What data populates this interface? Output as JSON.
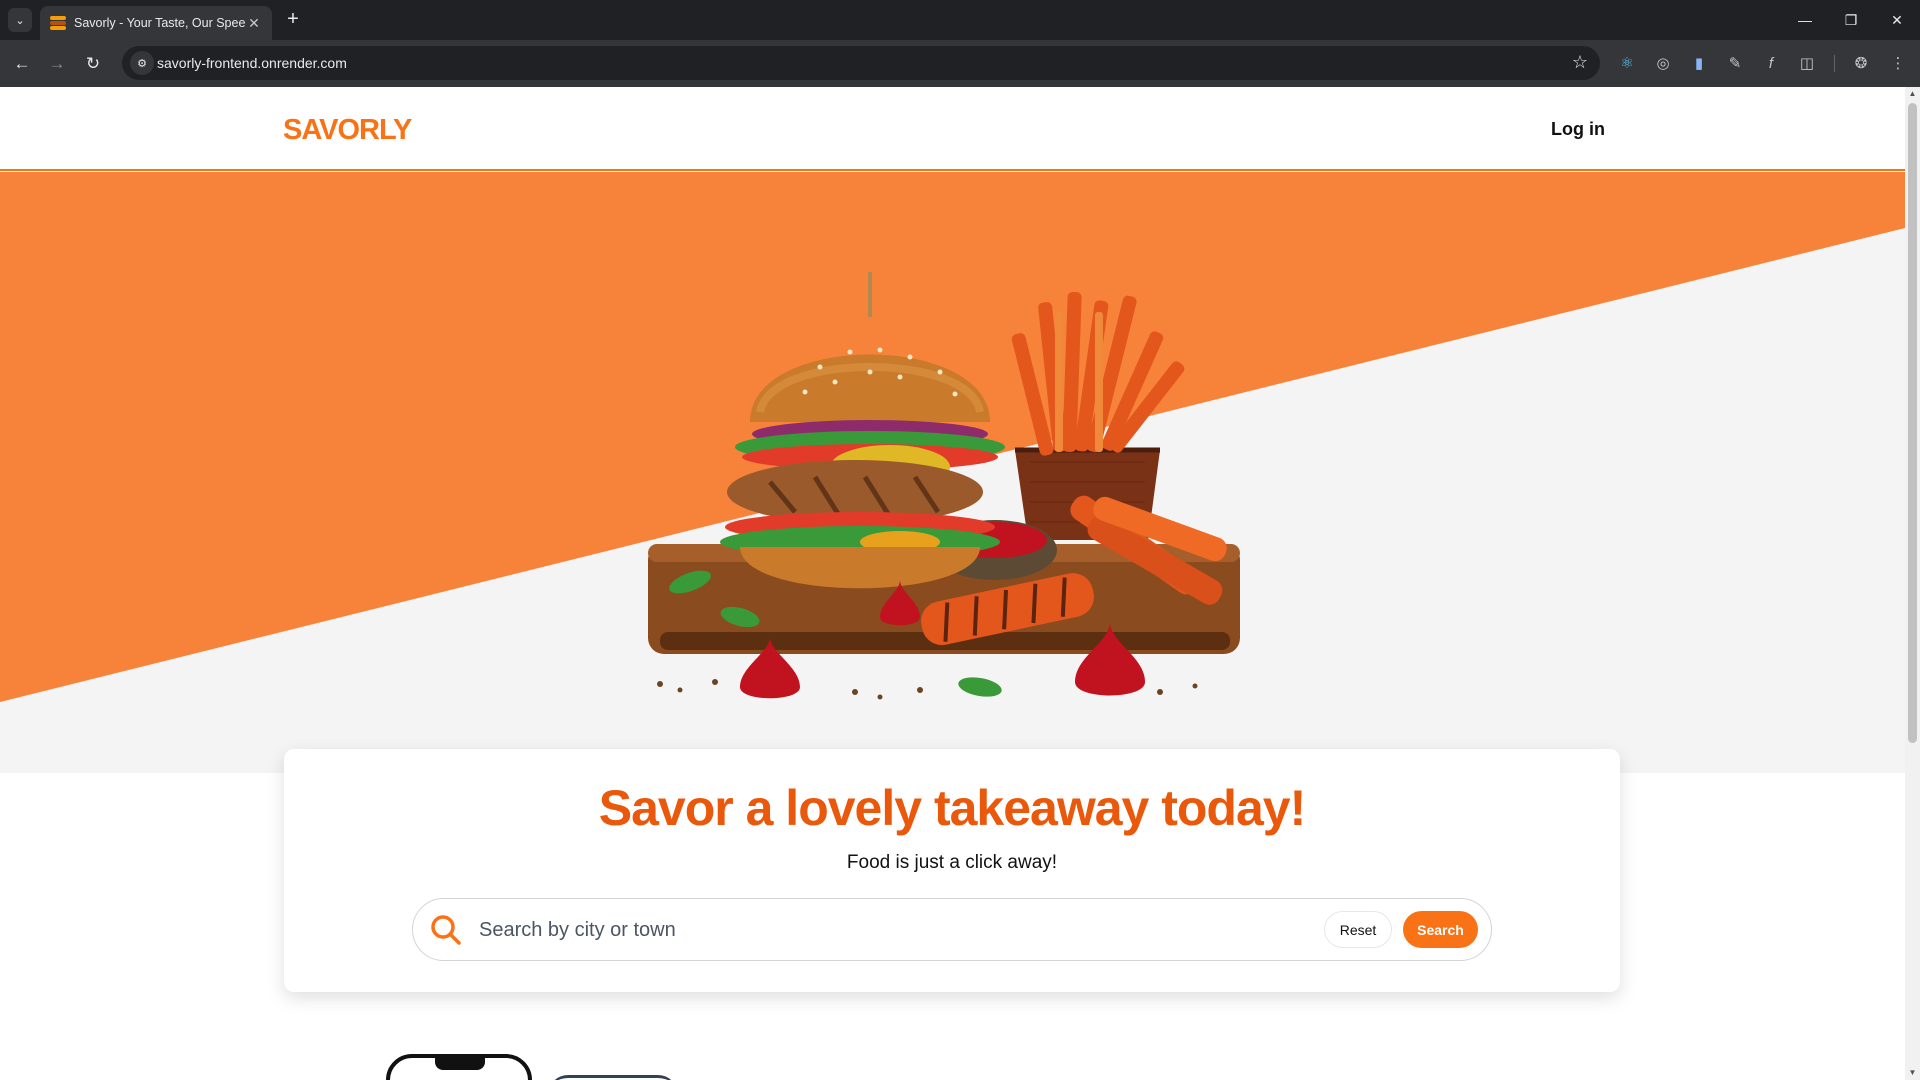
{
  "browser": {
    "tab_title": "Savorly - Your Taste, Our Speed",
    "url": "savorly-frontend.onrender.com"
  },
  "site": {
    "logo": "SAVORLY",
    "login_label": "Log in"
  },
  "hero": {
    "headline": "Savor a lovely takeaway today!",
    "subline": "Food is just a click away!"
  },
  "search": {
    "placeholder": "Search by city or town",
    "value": "",
    "reset_label": "Reset",
    "search_label": "Search"
  },
  "colors": {
    "brand_orange": "#f97316",
    "hero_orange": "#f7833b",
    "headline_orange": "#ea580c"
  },
  "icons": [
    "tab-search-icon",
    "burger-favicon-icon",
    "close-icon",
    "plus-icon",
    "back-icon",
    "forward-icon",
    "reload-icon",
    "site-info-icon",
    "star-icon",
    "extension-icon",
    "profile-icon",
    "menu-icon",
    "search-icon"
  ]
}
